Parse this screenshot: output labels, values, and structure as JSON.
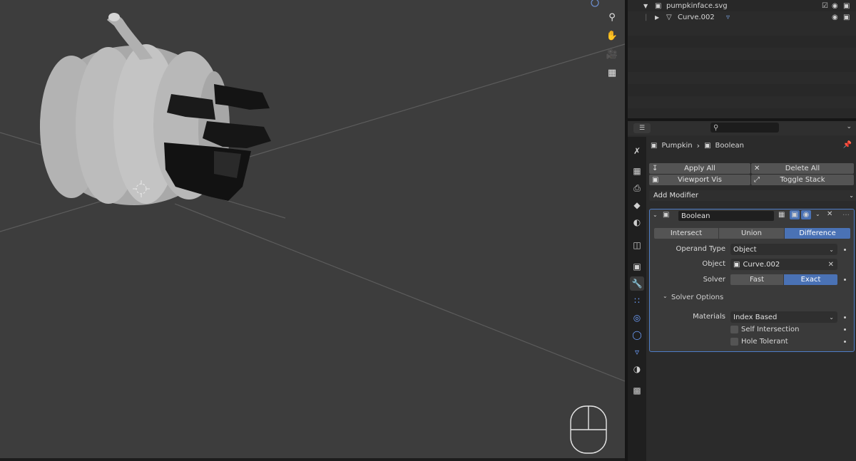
{
  "outliner": {
    "rows": [
      {
        "label": "pumpkinface.svg"
      },
      {
        "label": "Curve.002"
      }
    ]
  },
  "properties": {
    "breadcrumb": {
      "object": "Pumpkin",
      "modifier": "Boolean"
    },
    "toolbar": {
      "apply_all": "Apply All",
      "delete_all": "Delete All",
      "viewport_vis": "Viewport Vis",
      "toggle_stack": "Toggle Stack",
      "add_modifier": "Add Modifier"
    },
    "modifier": {
      "name": "Boolean",
      "operations": [
        "Intersect",
        "Union",
        "Difference"
      ],
      "active_operation": "Difference",
      "operand_type_label": "Operand Type",
      "operand_type": "Object",
      "object_label": "Object",
      "object": "Curve.002",
      "solver_label": "Solver",
      "solver_options": [
        "Fast",
        "Exact"
      ],
      "active_solver": "Exact",
      "solver_options_header": "Solver Options",
      "materials_label": "Materials",
      "materials": "Index Based",
      "self_intersection": "Self Intersection",
      "hole_tolerant": "Hole Tolerant"
    }
  },
  "colors": {
    "viewport_bg": "#3d3d3d",
    "accent": "#4a72b5",
    "panel_border": "#4e7dc7"
  }
}
